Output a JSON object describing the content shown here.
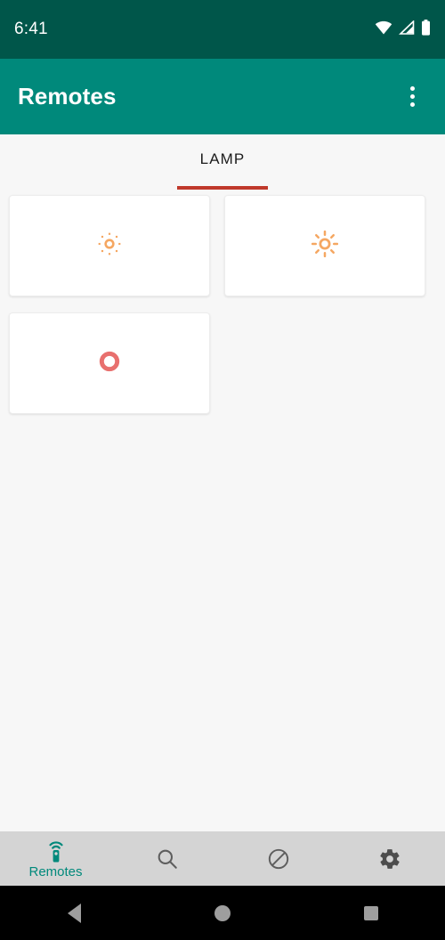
{
  "status_bar": {
    "time": "6:41",
    "icons": [
      "wifi-icon",
      "cellular-signal-icon",
      "battery-icon"
    ],
    "background_color": "#00564a"
  },
  "app_bar": {
    "title": "Remotes",
    "overflow_menu_label": "More options",
    "overflow_icon": "overflow-menu-icon",
    "background_color": "#00897b"
  },
  "tabs": [
    {
      "label": "LAMP",
      "selected": true,
      "indicator_color": "#c0392b"
    }
  ],
  "cards": [
    {
      "icon": "brightness-low-icon",
      "color": "#f5a762",
      "label": "Brightness down"
    },
    {
      "icon": "brightness-high-icon",
      "color": "#f5a762",
      "label": "Brightness up"
    },
    {
      "icon": "power-icon",
      "color": "#e8706e",
      "label": "Power"
    }
  ],
  "bottom_nav": {
    "background_color": "#d4d4d4",
    "active_color": "#00897b",
    "inactive_color": "#5e5e5e",
    "items": [
      {
        "label": "Remotes",
        "icon": "remote-control-icon",
        "active": true
      },
      {
        "label": "",
        "icon": "search-icon",
        "active": false
      },
      {
        "label": "",
        "icon": "block-icon",
        "active": false
      },
      {
        "label": "",
        "icon": "settings-gear-icon",
        "active": false
      }
    ]
  },
  "android_nav": {
    "back_label": "Back",
    "home_label": "Home",
    "recents_label": "Recents"
  }
}
